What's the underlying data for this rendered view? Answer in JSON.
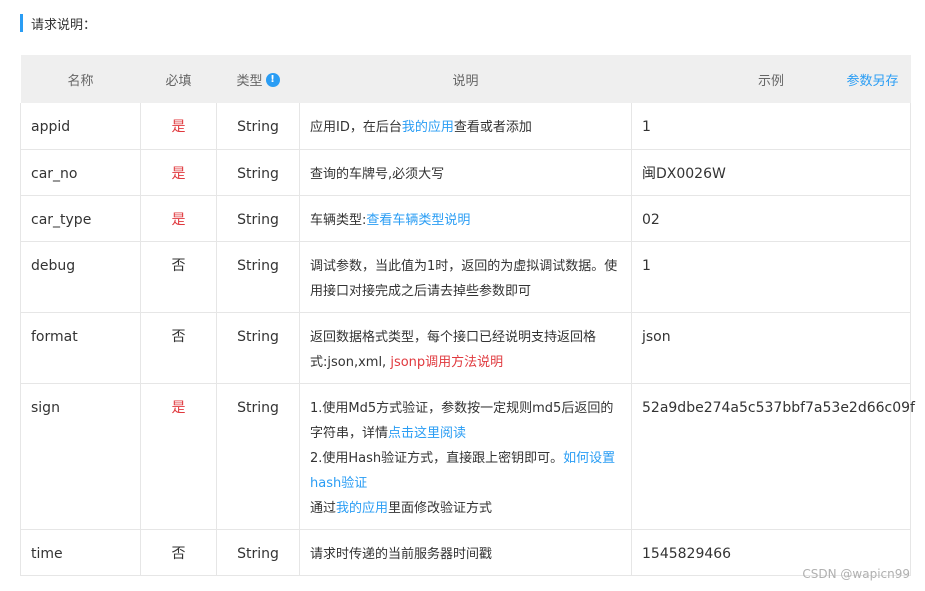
{
  "section_title": "请求说明：",
  "headers": {
    "name": "名称",
    "required": "必填",
    "type": "类型",
    "desc": "说明",
    "example": "示例",
    "save_params": "参数另存"
  },
  "rows": [
    {
      "name": "appid",
      "required": "是",
      "required_flag": true,
      "type": "String",
      "desc": [
        {
          "t": "应用ID，在后台"
        },
        {
          "t": "我的应用",
          "link": true
        },
        {
          "t": "查看或者添加"
        }
      ],
      "example": "1"
    },
    {
      "name": "car_no",
      "required": "是",
      "required_flag": true,
      "type": "String",
      "desc": [
        {
          "t": "查询的车牌号,必须大写"
        }
      ],
      "example": "闽DX0026W"
    },
    {
      "name": "car_type",
      "required": "是",
      "required_flag": true,
      "type": "String",
      "desc": [
        {
          "t": "车辆类型:"
        },
        {
          "t": "查看车辆类型说明",
          "link": true
        }
      ],
      "example": "02"
    },
    {
      "name": "debug",
      "required": "否",
      "required_flag": false,
      "type": "String",
      "desc": [
        {
          "t": "调试参数，当此值为1时，返回的为虚拟调试数据。使用接口对接完成之后请去掉些参数即可"
        }
      ],
      "example": "1"
    },
    {
      "name": "format",
      "required": "否",
      "required_flag": false,
      "type": "String",
      "desc": [
        {
          "t": "返回数据格式类型，每个接口已经说明支持返回格式:json,xml, "
        },
        {
          "t": "jsonp调用方法说明",
          "red": true
        }
      ],
      "example": "json"
    },
    {
      "name": "sign",
      "required": "是",
      "required_flag": true,
      "type": "String",
      "desc": [
        {
          "t": "1.使用Md5方式验证，参数按一定规则md5后返回的字符串，详情"
        },
        {
          "t": "点击这里阅读",
          "link": true
        },
        {
          "br": true
        },
        {
          "t": "2.使用Hash验证方式，直接跟上密钥即可。"
        },
        {
          "t": "如何设置hash验证",
          "link": true
        },
        {
          "br": true
        },
        {
          "t": "通过"
        },
        {
          "t": "我的应用",
          "link": true
        },
        {
          "t": "里面修改验证方式"
        }
      ],
      "example": "52a9dbe274a5c537bbf7a53e2d66c09f"
    },
    {
      "name": "time",
      "required": "否",
      "required_flag": false,
      "type": "String",
      "desc": [
        {
          "t": "请求时传递的当前服务器时间戳"
        }
      ],
      "example": "1545829466"
    }
  ],
  "watermark": "CSDN @wapicn99"
}
